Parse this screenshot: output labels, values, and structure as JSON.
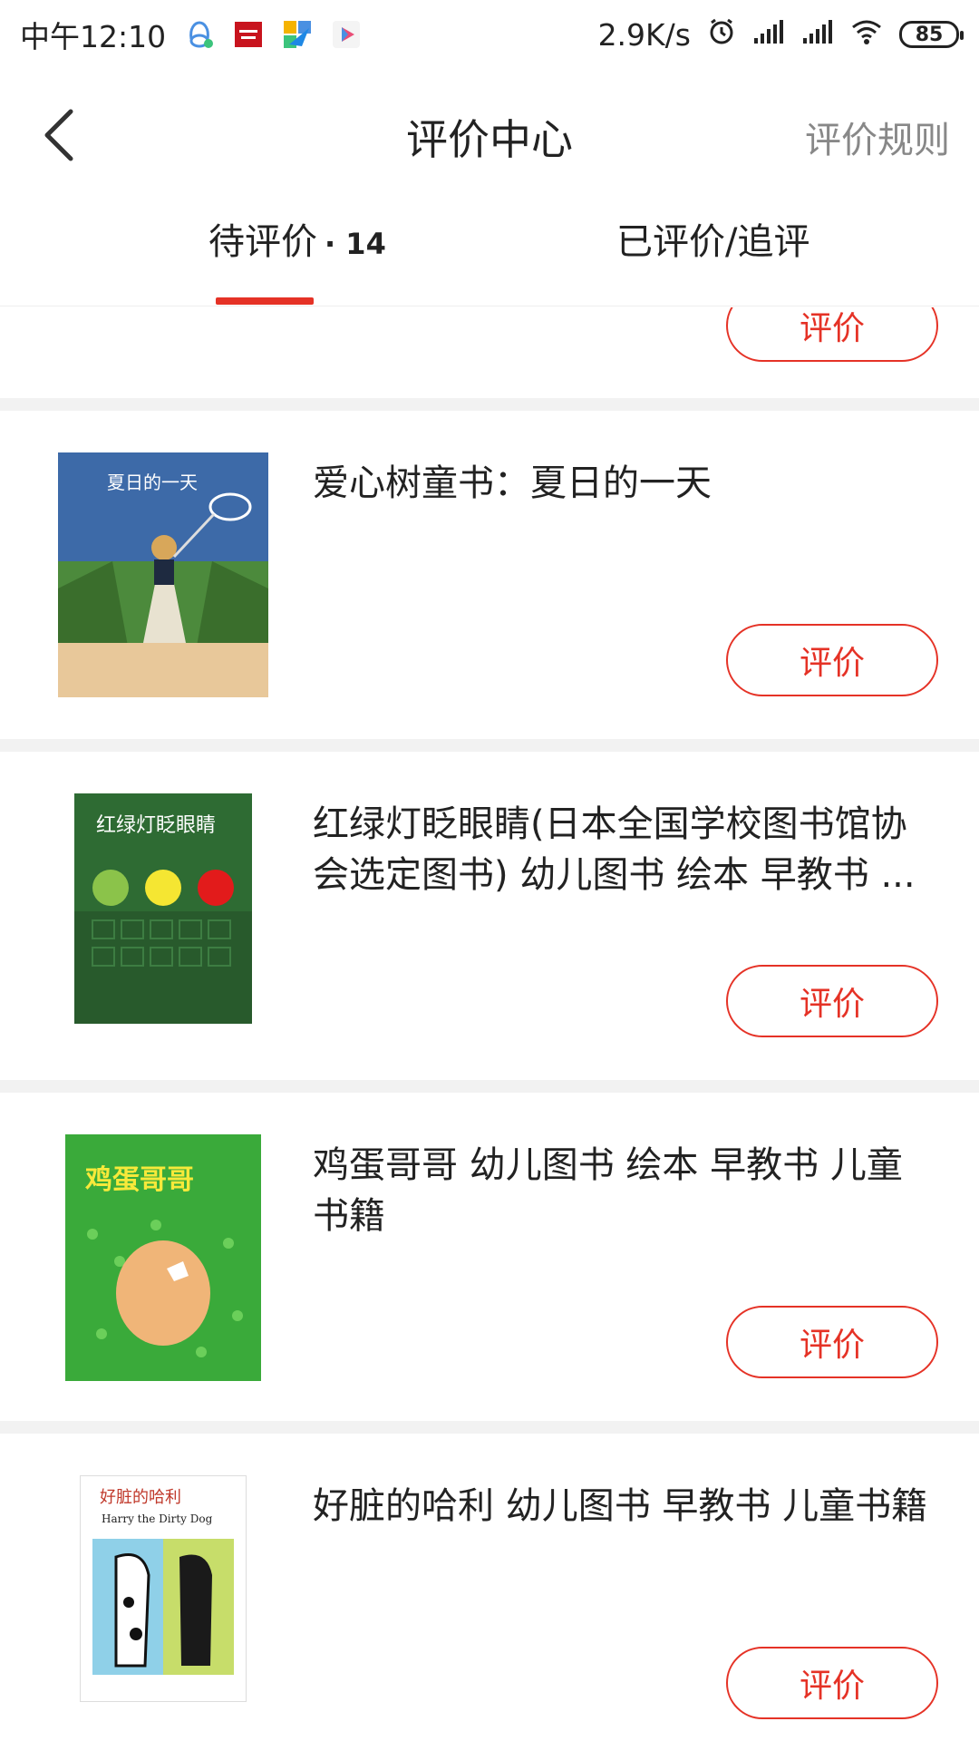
{
  "status_bar": {
    "time": "中午12:10",
    "network_speed": "2.9K/s",
    "battery": "85",
    "app_icons": [
      "qq-icon",
      "netease-icon",
      "message-icon",
      "play-store-icon"
    ]
  },
  "nav": {
    "title": "评价中心",
    "rules_label": "评价规则"
  },
  "tabs": {
    "pending_label": "待评价",
    "pending_separator": "·",
    "pending_count": "14",
    "done_label": "已评价/追评"
  },
  "rate_label": "评价",
  "items": [
    {
      "title": "爱心树童书：夏日的一天",
      "cover_title": "夏日的一天"
    },
    {
      "title": "红绿灯眨眼睛(日本全国学校图书馆协会选定图书) 幼儿图书 绘本 早教书 ...",
      "cover_title": "红绿灯眨眼睛"
    },
    {
      "title": "鸡蛋哥哥 幼儿图书 绘本 早教书 儿童书籍",
      "cover_title": "鸡蛋哥哥"
    },
    {
      "title": "好脏的哈利 幼儿图书 早教书 儿童书籍",
      "cover_title": "好脏的哈利",
      "cover_subtitle": "Harry the Dirty Dog"
    }
  ],
  "colors": {
    "accent": "#e53226",
    "divider": "#f2f2f2"
  }
}
